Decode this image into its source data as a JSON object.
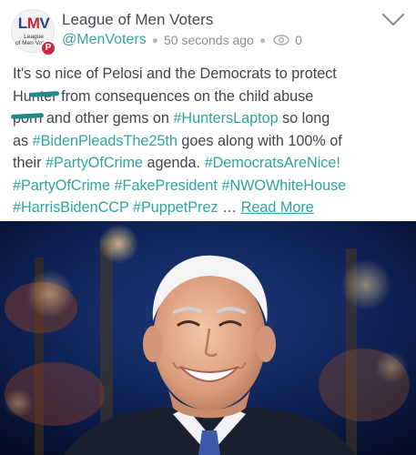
{
  "post": {
    "author_name": "League of Men Voters",
    "handle": "@MenVoters",
    "timestamp": "50 seconds ago",
    "views": "0",
    "avatar": {
      "big": [
        "L",
        "M",
        "V"
      ],
      "small_line1": "League",
      "small_line2": "of Men Voters",
      "badge": "P"
    },
    "text": {
      "l1": "It's so nice of Pelosi and the Democrats to protect",
      "l2_pre": "Hu",
      "l2_redact": "nter",
      "l2_post": " from consequences on the child abuse",
      "l3_redact": "porn",
      "l3_post": " and other gems on ",
      "l3_tag": "#HuntersLaptop",
      "l3_tail": " so long",
      "l4_pre": "as ",
      "l4_tag": "#BidenPleadsThe25th",
      "l4_post": " goes along with 100% of",
      "l5_pre": "their ",
      "l5_tag1": "#PartyOfCrime",
      "l5_mid": " agenda. ",
      "l5_tag2": "#DemocratsAreNice!",
      "l6_tag1": "#PartyOfCrime",
      "l6_tag2": "#FakePresident",
      "l6_tag3": "#NWOWhiteHouse",
      "l7_tag1": "#HarrisBidenCCP",
      "l7_tag2": "#PuppetPrez",
      "ellipsis": " … ",
      "read_more": "Read More"
    }
  },
  "colors": {
    "accent": "#2da6a2",
    "text": "#3f4650",
    "muted": "#8a8f96",
    "redaction": "#1f8a8a"
  },
  "icons": [
    "chevron-down-icon",
    "eye-icon",
    "parler-badge-icon"
  ]
}
